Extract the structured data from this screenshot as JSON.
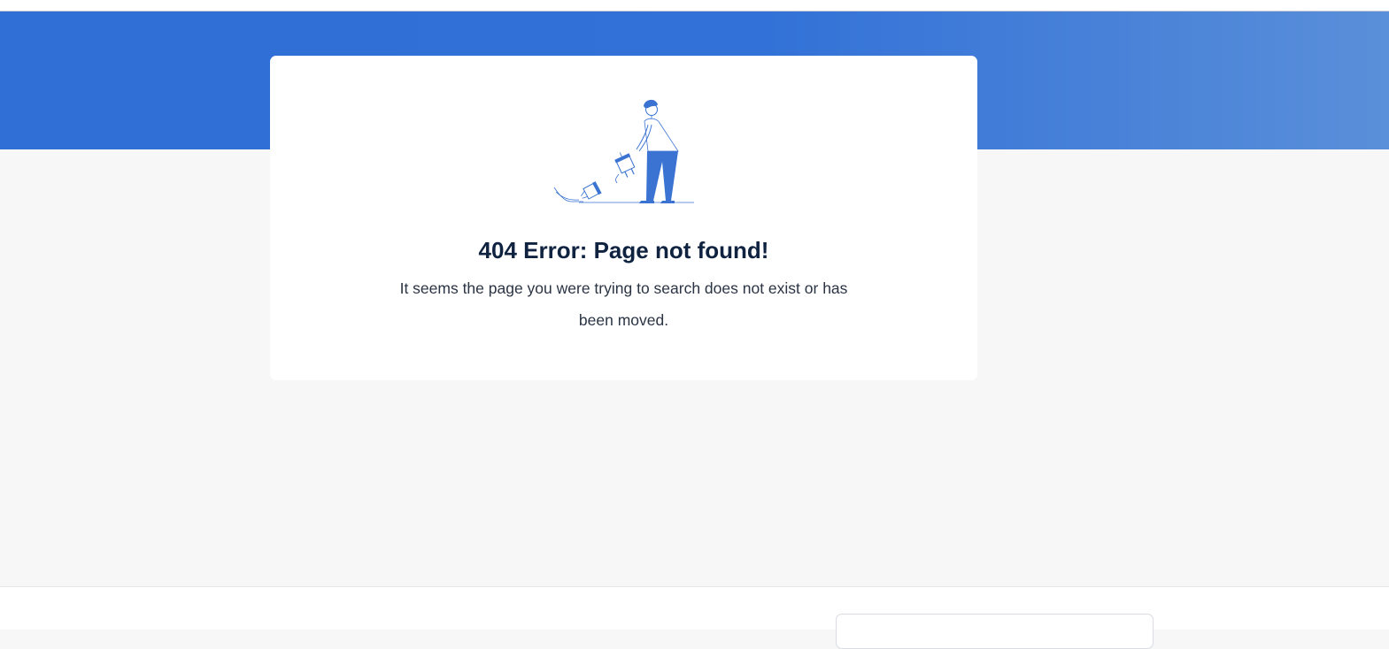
{
  "error": {
    "title": "404 Error: Page not found!",
    "message": "It seems the page you were trying to search does not exist or has been moved.",
    "illustration_icon": "unplugged-cable-person-icon"
  },
  "colors": {
    "banner": "#2f6fd6",
    "accent": "#3a73d2",
    "title": "#0f2340",
    "body_text": "#2b3444",
    "page_background": "#f7f7f7"
  }
}
